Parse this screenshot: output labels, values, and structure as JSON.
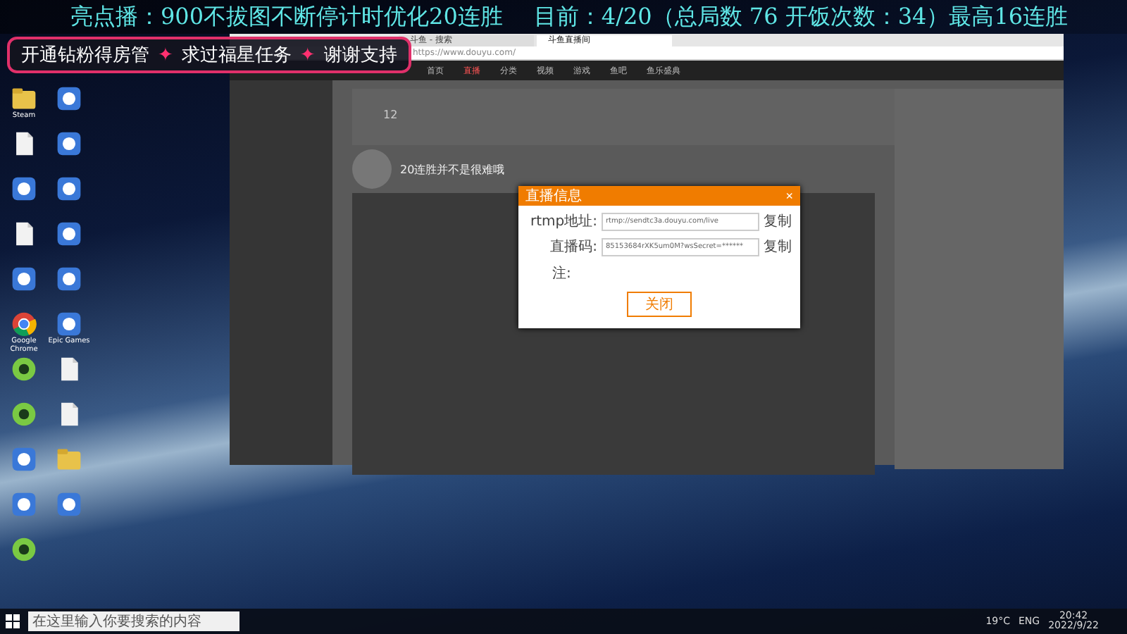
{
  "overlay": {
    "headline": "亮点播：900不拔图不断停计时优化20连胜",
    "record": "目前：4/20（总局数 76  开饭次数：34）最高16连胜",
    "separator": "✦",
    "promos": [
      "开通钻粉得房管",
      "求过福星任务",
      "谢谢支持"
    ]
  },
  "desktop_icons": [
    {
      "kind": "folder",
      "label": "Steam"
    },
    {
      "kind": "app"
    },
    {
      "kind": "doc"
    },
    {
      "kind": "app"
    },
    {
      "kind": "app"
    },
    {
      "kind": "app"
    },
    {
      "kind": "doc"
    },
    {
      "kind": "app"
    },
    {
      "kind": "app"
    },
    {
      "kind": "app"
    },
    {
      "kind": "browser",
      "label": "Google Chrome"
    },
    {
      "kind": "app",
      "label": "Epic Games"
    },
    {
      "kind": "circle"
    },
    {
      "kind": "doc"
    },
    {
      "kind": "circle"
    },
    {
      "kind": "doc"
    },
    {
      "kind": "app"
    },
    {
      "kind": "folder"
    },
    {
      "kind": "app"
    },
    {
      "kind": "app"
    },
    {
      "kind": "circle"
    }
  ],
  "browser": {
    "tabs": [
      {
        "title": "斗鱼 - 搜索",
        "selected": false
      },
      {
        "title": "斗鱼直播间",
        "selected": true
      }
    ],
    "address": "https://www.douyu.com/",
    "nav": [
      "首页",
      "直播",
      "分类",
      "视频",
      "游戏",
      "鱼吧",
      "鱼乐盛典"
    ],
    "room": {
      "title": "20连胜并不是很难哦",
      "count": "12"
    },
    "dialog": {
      "title": "直播信息",
      "close": "×",
      "fields": [
        {
          "label": "rtmp地址:",
          "value": "rtmp://sendtc3a.douyu.com/live",
          "action": "复制"
        },
        {
          "label": "直播码:",
          "value": "85153684rXK5um0M?wsSecret=******",
          "action": "复制"
        }
      ],
      "notes_title": "注:",
      "button": "关闭"
    }
  },
  "taskbar": {
    "search_placeholder": "在这里输入你要搜索的内容",
    "weather": "19°C",
    "language": "ENG",
    "time": "20:42",
    "date": "2022/9/22"
  }
}
